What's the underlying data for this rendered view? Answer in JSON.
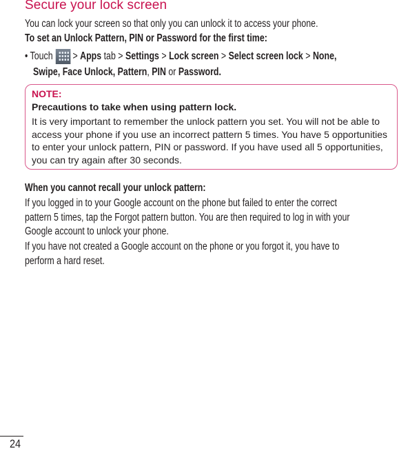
{
  "title": "Secure your lock screen",
  "intro": "You can lock your screen so that only you can unlock it to access your phone.",
  "subheading": "To set an Unlock Pattern, PIN or Password for the first time:",
  "instruction": {
    "bullet": "•",
    "touch": "Touch",
    "icon": "apps-grid-icon",
    "sep": ">",
    "apps": "Apps",
    "tab": "tab",
    "settings": "Settings",
    "lock_screen": "Lock screen",
    "select_screen_lock": "Select screen lock",
    "options_line1": "None,",
    "options_line2a": "Swipe, Face Unlock, Pattern",
    "comma": ",",
    "pin": "PIN",
    "or": "or",
    "password": "Password."
  },
  "note": {
    "label": "NOTE:",
    "heading": "Precautions to take when using pattern lock.",
    "body": "It is very important to remember the unlock pattern you set. You will not be able to access your phone if you use an incorrect pattern 5 times. You have 5 opportunities to enter your unlock pattern, PIN or password. If you have used all 5 opportunities, you can try again after 30 seconds."
  },
  "recall": {
    "heading": "When you cannot recall your unlock pattern:",
    "para1_lines": [
      "If you logged in to your Google account on the phone but failed to enter the correct",
      "pattern 5 times, tap the Forgot pattern button. You are then required to log in with your",
      "Google account to unlock your phone."
    ],
    "para2_lines": [
      "If you have not created a Google account on the phone or you forgot it, you have to",
      "perform a hard reset."
    ]
  },
  "page_number": "24",
  "colors": {
    "accent": "#c8124f",
    "note_border": "#d9578a",
    "text": "#231f20"
  }
}
